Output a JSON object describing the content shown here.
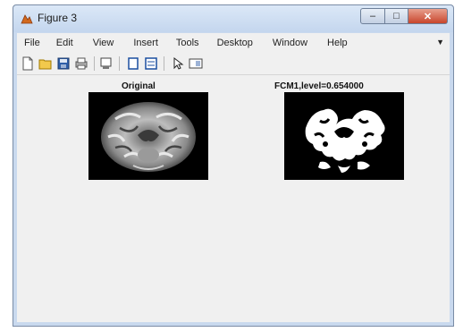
{
  "window": {
    "title": "Figure 3",
    "controls": {
      "minimize": "–",
      "maximize": "□",
      "close": "✕"
    }
  },
  "menu": [
    "File",
    "Edit",
    "View",
    "Insert",
    "Tools",
    "Desktop",
    "Window",
    "Help"
  ],
  "toolbar": [
    "new-figure-icon",
    "open-file-icon",
    "save-icon",
    "print-icon",
    "zoom-icon",
    "brush-icon",
    "colorbar-icon",
    "legend-icon",
    "pointer-icon",
    "property-editor-icon"
  ],
  "figure": {
    "axes": [
      {
        "title": "Original",
        "content": "grayscale MRI brain slice"
      },
      {
        "title": "FCM1,level=0.654000",
        "content": "binary segmented brain mask"
      }
    ]
  },
  "colors": {
    "titlebar": "#c4d6ee",
    "canvas": "#f0f0f0",
    "close": "#c8452c"
  }
}
